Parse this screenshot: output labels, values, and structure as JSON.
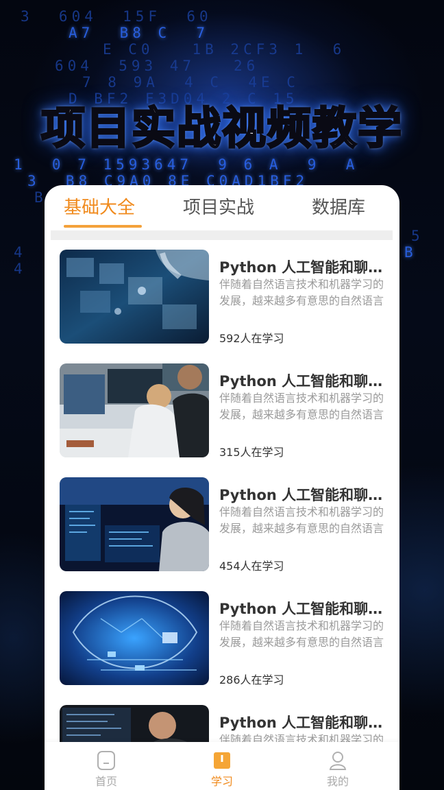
{
  "banner_title": "项目实战视频教学",
  "tabs": [
    {
      "label": "基础大全",
      "active": true
    },
    {
      "label": "项目实战",
      "active": false
    },
    {
      "label": "数据库",
      "active": false
    }
  ],
  "courses": [
    {
      "title": "Python 人工智能和聊天机器人",
      "description": "伴随着自然语言技术和机器学习的发展，越来越多有意思的自然语言小项目呈现在大家眼前",
      "learners": "592人在学习",
      "image": "hand-touching-digital-network"
    },
    {
      "title": "Python 人工智能和聊天机器人",
      "description": "伴随着自然语言技术和机器学习的发展，越来越多有意思的自然语言小项目呈现在大家眼前",
      "learners": "315人在学习",
      "image": "people-at-computer-desk"
    },
    {
      "title": "Python 人工智能和聊天机器人",
      "description": "伴随着自然语言技术和机器学习的发展，越来越多有意思的自然语言小项目呈现在大家眼前",
      "learners": "454人在学习",
      "image": "woman-at-code-monitors"
    },
    {
      "title": "Python 人工智能和聊天机器人",
      "description": "伴随着自然语言技术和机器学习的发展，越来越多有意思的自然语言小项目呈现在大家眼前",
      "learners": "286人在学习",
      "image": "glowing-circuit-chip"
    },
    {
      "title": "Python 人工智能和聊天机器人",
      "description": "伴随着自然语言技术和机器学习的发展，越来越多有意思的自然语言小项目呈现在大家眼前",
      "learners": "",
      "image": "man-at-code-monitor"
    }
  ],
  "nav": [
    {
      "label": "首页",
      "icon": "home-icon",
      "active": false
    },
    {
      "label": "学习",
      "icon": "book-icon",
      "active": true
    },
    {
      "label": "我的",
      "icon": "user-icon",
      "active": false
    }
  ],
  "colors": {
    "accent": "#f08a1c",
    "underline": "#f4a23b",
    "glow": "#2f6dff"
  }
}
